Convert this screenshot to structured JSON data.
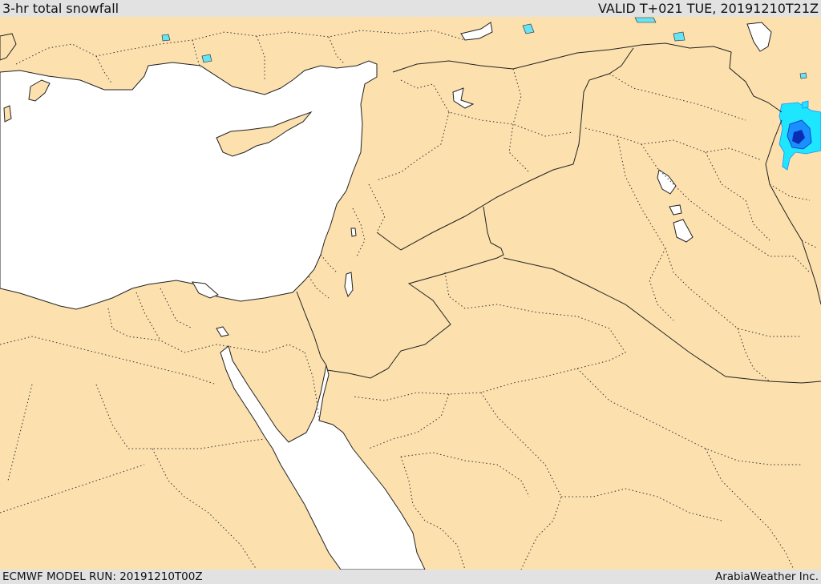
{
  "header": {
    "title": "3-hr total snowfall",
    "valid": "VALID T+021 TUE, 20191210T21Z"
  },
  "footer": {
    "model_run": "ECMWF MODEL RUN: 20191210T00Z",
    "credit": "ArabiaWeather Inc."
  },
  "map": {
    "colors": {
      "land": "#fce0ae",
      "sea": "#ffffff",
      "border": "#222222",
      "snow_light": "#1ee6ff",
      "snow_medium": "#1a8fff",
      "snow_heavy": "#0a2db4"
    }
  }
}
